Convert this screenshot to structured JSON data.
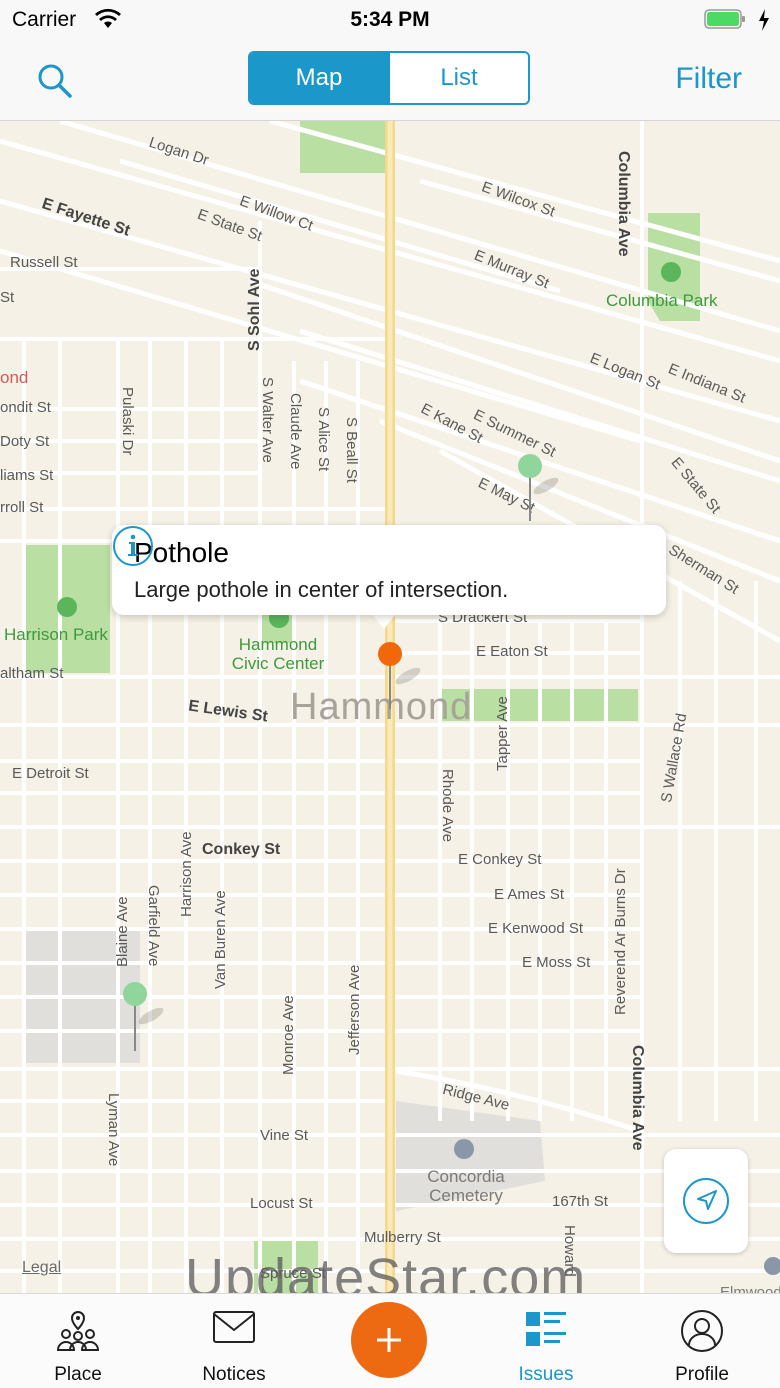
{
  "status": {
    "carrier": "Carrier",
    "time": "5:34 PM"
  },
  "nav": {
    "segments": [
      "Map",
      "List"
    ],
    "active": "Map",
    "filter": "Filter"
  },
  "map": {
    "city": "Hammond",
    "streets": [
      "Logan Dr",
      "E Fayette St",
      "E State St",
      "E Willow Ct",
      "E Wilcox St",
      "Columbia Ave",
      "Russell St",
      "S Sohl Ave",
      "E Murray St",
      "Columbia Park",
      "E Logan St",
      "E Indiana St",
      "Pulaski Dr",
      "S Walter Ave",
      "Claude Ave",
      "S Alice St",
      "S Beall St",
      "E Kane St",
      "E Summer St",
      "E May St",
      "E State St",
      "Sherman St",
      "Harrison Park",
      "Hammond Civic Center",
      "S Drackert St",
      "E Eaton St",
      "E Lewis St",
      "Tapper Ave",
      "S Wallace Rd",
      "E Detroit St",
      "Rhode Ave",
      "Conkey St",
      "E Conkey St",
      "E Ames St",
      "E Kenwood St",
      "E Moss St",
      "Reverend Ar Burns Dr",
      "Harrison Ave",
      "Blaine Ave",
      "Garfield Ave",
      "Van Buren Ave",
      "Monroe Ave",
      "Jefferson Ave",
      "Columbia Ave",
      "Ridge Ave",
      "Lyman Ave",
      "Vine St",
      "Concordia Cemetery",
      "Locust St",
      "167th St",
      "Howard",
      "Mulberry St",
      "Spruce St",
      "Elmwood",
      "ondit St",
      "Doty St",
      "liams St",
      "rroll St",
      "altham St",
      "St",
      "ond"
    ],
    "legal": "Legal",
    "watermark": "UpdateStar.com"
  },
  "callout": {
    "title": "Pothole",
    "description": "Large pothole in center of intersection."
  },
  "tabs": [
    {
      "label": "Place",
      "icon": "place-icon"
    },
    {
      "label": "Notices",
      "icon": "envelope-icon"
    },
    {
      "label": "",
      "icon": "plus-icon"
    },
    {
      "label": "Issues",
      "icon": "issues-icon"
    },
    {
      "label": "Profile",
      "icon": "profile-icon"
    }
  ],
  "active_tab": "Issues",
  "colors": {
    "accent": "#1b97c9",
    "fab": "#ee6a12",
    "park": "#b9dfa3",
    "road": "#ffffff",
    "highway": "#f5d88a",
    "pin_green": "#8fd59c",
    "pin_orange": "#f0680a"
  }
}
